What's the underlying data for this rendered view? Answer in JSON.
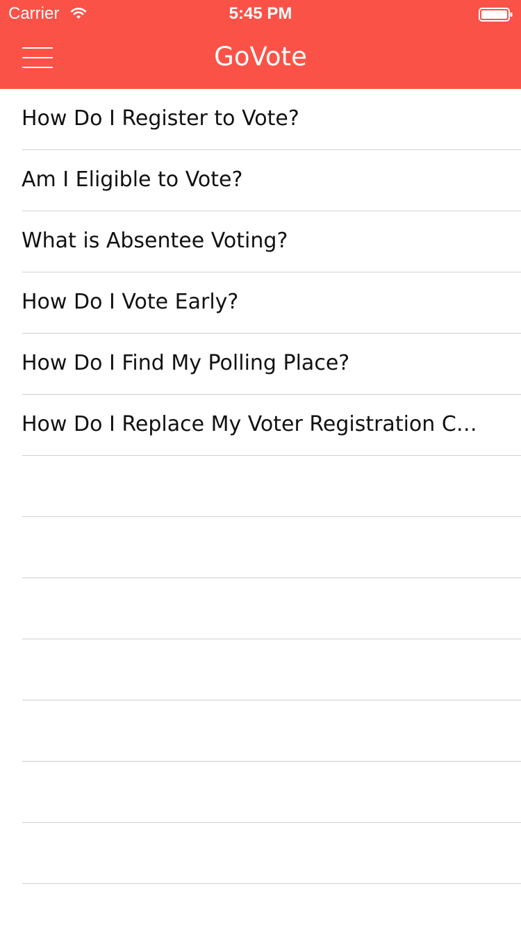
{
  "status_bar": {
    "carrier": "Carrier",
    "time": "5:45 PM",
    "icons": [
      "wifi-icon",
      "battery-icon"
    ]
  },
  "nav": {
    "title": "GoVote",
    "menu_icon": "hamburger-menu-icon",
    "accent_color": "#fb5247"
  },
  "list": {
    "items": [
      {
        "label": "How Do I Register to Vote?"
      },
      {
        "label": "Am I Eligible to Vote?"
      },
      {
        "label": "What is Absentee Voting?"
      },
      {
        "label": "How Do I Vote Early?"
      },
      {
        "label": "How Do I Find My Polling Place?"
      },
      {
        "label": "How Do I Replace My Voter Registration C…"
      }
    ]
  }
}
